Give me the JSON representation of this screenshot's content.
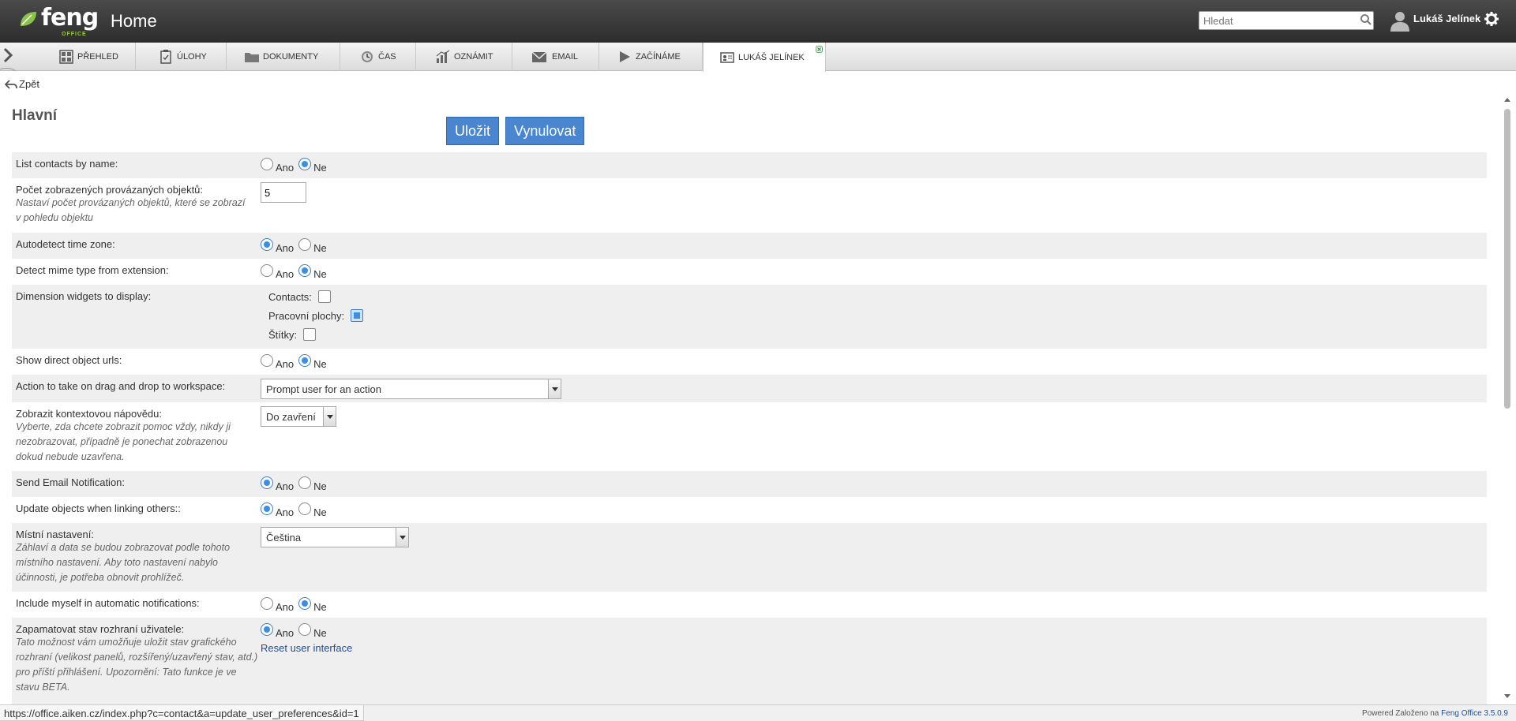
{
  "header": {
    "logo_text": "feng",
    "logo_sub": "OFFICE",
    "title": "Home",
    "search_placeholder": "Hledat",
    "user_name": "Lukáš Jelínek"
  },
  "tabs": [
    {
      "label": "PŘEHLED",
      "icon": "dashboard-icon"
    },
    {
      "label": "ÚLOHY",
      "icon": "tasks-icon"
    },
    {
      "label": "DOKUMENTY",
      "icon": "folder-icon"
    },
    {
      "label": "ČAS",
      "icon": "clock-icon"
    },
    {
      "label": "OZNÁMIT",
      "icon": "chart-icon"
    },
    {
      "label": "EMAIL",
      "icon": "envelope-icon"
    },
    {
      "label": "ZAČÍNÁME",
      "icon": "play-icon"
    },
    {
      "label": "LUKÁŠ JELÍNEK",
      "icon": "contact-card-icon",
      "active": true
    }
  ],
  "back_label": "Zpět",
  "section_title": "Hlavní",
  "buttons": {
    "save": "Uložit",
    "reset": "Vynulovat"
  },
  "radio_labels": {
    "yes": "Ano",
    "no": "Ne"
  },
  "settings": {
    "list_contacts": {
      "label": "List contacts by name:",
      "value": "Ne"
    },
    "linked_count": {
      "label": "Počet zobrazených provázaných objektů:",
      "desc": "Nastaví počet provázaných objektů, které se zobrazí v pohledu objektu",
      "value": "5"
    },
    "autodetect_tz": {
      "label": "Autodetect time zone:",
      "value": "Ano"
    },
    "detect_mime": {
      "label": "Detect mime type from extension:",
      "value": "Ne"
    },
    "dimension_widgets": {
      "label": "Dimension widgets to display:",
      "items": [
        {
          "label": "Contacts:",
          "checked": false
        },
        {
          "label": "Pracovní plochy:",
          "checked": true
        },
        {
          "label": "Štítky:",
          "checked": false
        }
      ]
    },
    "direct_urls": {
      "label": "Show direct object urls:",
      "value": "Ne"
    },
    "drag_drop": {
      "label": "Action to take on drag and drop to workspace:",
      "value": "Prompt user for an action"
    },
    "context_help": {
      "label": "Zobrazit kontextovou nápovědu:",
      "desc": "Vyberte, zda chcete zobrazit pomoc vždy, nikdy ji nezobrazovat, případně je ponechat zobrazenou dokud nebude uzavřena.",
      "value": "Do zavření"
    },
    "email_notification": {
      "label": "Send Email Notification:",
      "value": "Ano"
    },
    "update_linking": {
      "label": "Update objects when linking others::",
      "value": "Ano"
    },
    "locale": {
      "label": "Místní nastavení:",
      "desc": "Záhlaví a data se budou zobrazovat podle tohoto místního nastavení. Aby toto nastavení nabylo účinnosti, je potřeba obnovit prohlížeč.",
      "value": "Čeština"
    },
    "include_myself": {
      "label": "Include myself in automatic notifications:",
      "value": "Ne"
    },
    "remember_ui": {
      "label": "Zapamatovat stav rozhraní uživatele:",
      "desc": "Tato možnost vám umožňuje uložit stav grafického rozhraní (velikost panelů, rozšířený/uzavřený stav, atd.) pro příští přihlášení. Upozornění: Tato funkce je ve stavu BETA.",
      "value": "Ano",
      "reset_link": "Reset user interface"
    }
  },
  "status_url": "https://office.aiken.cz/index.php?c=contact&a=update_user_preferences&id=1",
  "footer": {
    "powered": "Powered Založeno na",
    "link": "Feng Office 3.5.0.9"
  },
  "colors": {
    "header": "#3a3a3a",
    "button": "#4a86cf",
    "accent": "#9acd32"
  }
}
